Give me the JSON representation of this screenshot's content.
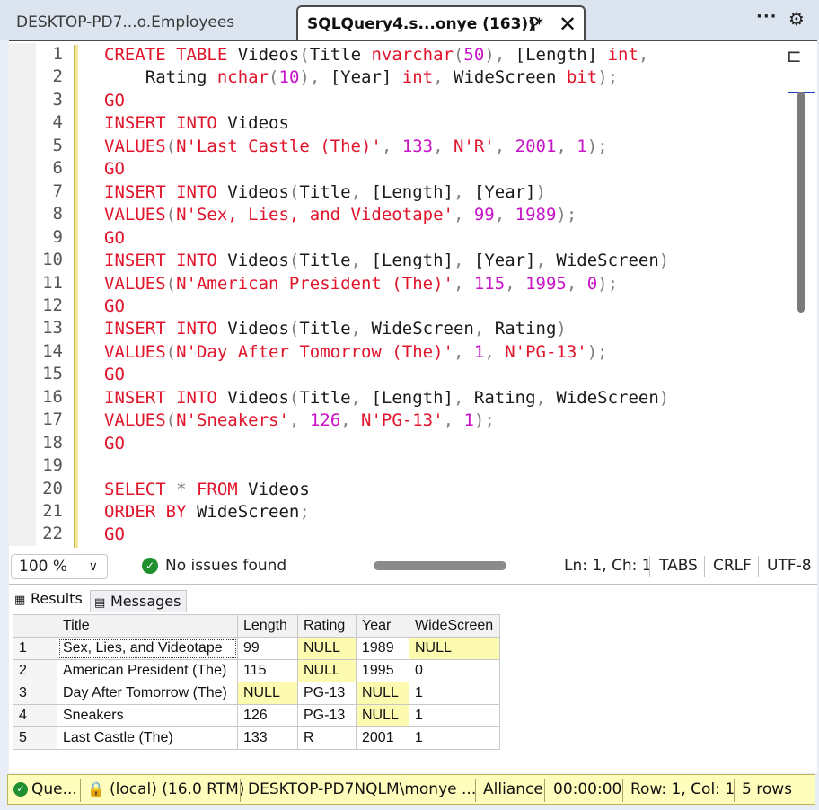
{
  "tabs": [
    {
      "label": "DESKTOP-PD7...o.Employees"
    },
    {
      "label": "SQLQuery4.s...onye (163))*"
    }
  ],
  "icons": {
    "pin": "pin-icon",
    "close": "close-icon",
    "more": "more-icon",
    "settings": "gear-icon"
  },
  "editor": {
    "line_numbers": [
      "1",
      "2",
      "3",
      "4",
      "5",
      "6",
      "7",
      "8",
      "9",
      "10",
      "11",
      "12",
      "13",
      "14",
      "15",
      "16",
      "17",
      "18",
      "19",
      "20",
      "21",
      "22"
    ]
  },
  "editor_status": {
    "zoom": "100 %",
    "issues": "No issues found",
    "position": "Ln: 1, Ch: 1",
    "indent": "TABS",
    "line_ending": "CRLF",
    "encoding": "UTF-8"
  },
  "results_tabs": {
    "results": "Results",
    "messages": "Messages"
  },
  "grid": {
    "columns": [
      "Title",
      "Length",
      "Rating",
      "Year",
      "WideScreen"
    ],
    "rows": [
      [
        "1",
        "Sex, Lies, and Videotape",
        "99",
        "NULL",
        "1989",
        "NULL"
      ],
      [
        "2",
        "American President (The)",
        "115",
        "NULL",
        "1995",
        "0"
      ],
      [
        "3",
        "Day After Tomorrow (The)",
        "NULL",
        "PG-13",
        "NULL",
        "1"
      ],
      [
        "4",
        "Sneakers",
        "126",
        "PG-13",
        "NULL",
        "1"
      ],
      [
        "5",
        "Last Castle (The)",
        "133",
        "R",
        "2001",
        "1"
      ]
    ]
  },
  "status_bar": {
    "query": "Que...",
    "server": "(local) (16.0 RTM)",
    "user": "DESKTOP-PD7NQLM\\monye ...",
    "database": "Alliance",
    "elapsed": "00:00:00",
    "rowcol": "Row: 1, Col: 1",
    "rows": "5 rows"
  },
  "colors": {
    "keyword": "#e0142b",
    "number": "#c814c8",
    "null_cell": "#fdfbb0",
    "status_bar": "#fffdbb"
  }
}
